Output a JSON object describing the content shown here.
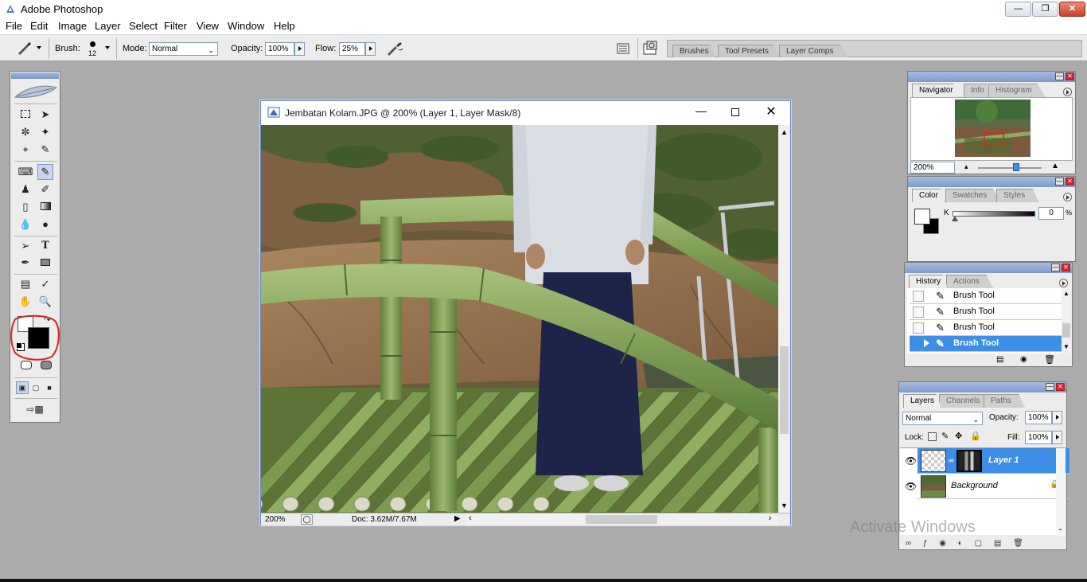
{
  "app": {
    "title": "Adobe Photoshop"
  },
  "menu": [
    "File",
    "Edit",
    "Image",
    "Layer",
    "Select",
    "Filter",
    "View",
    "Window",
    "Help"
  ],
  "options": {
    "brush_label": "Brush:",
    "brush_size": "12",
    "mode_label": "Mode:",
    "mode_value": "Normal",
    "opacity_label": "Opacity:",
    "opacity_value": "100%",
    "flow_label": "Flow:",
    "flow_value": "25%",
    "well_tabs": [
      "Brushes",
      "Tool Presets",
      "Layer Comps"
    ]
  },
  "document": {
    "title": "Jembatan Kolam.JPG @ 200% (Layer 1, Layer Mask/8)",
    "zoom": "200%",
    "doc_info": "Doc: 3.62M/7.67M"
  },
  "navigator": {
    "tabs": [
      "Navigator",
      "Info",
      "Histogram"
    ],
    "zoom": "200%"
  },
  "color": {
    "tabs": [
      "Color",
      "Swatches",
      "Styles"
    ],
    "channel_label": "K",
    "value": "0",
    "unit": "%"
  },
  "history": {
    "tabs": [
      "History",
      "Actions"
    ],
    "items": [
      "Brush Tool",
      "Brush Tool",
      "Brush Tool",
      "Brush Tool"
    ]
  },
  "layers": {
    "tabs": [
      "Layers",
      "Channels",
      "Paths"
    ],
    "blend_mode": "Normal",
    "opacity_label": "Opacity:",
    "opacity_value": "100%",
    "lock_label": "Lock:",
    "fill_label": "Fill:",
    "fill_value": "100%",
    "items": [
      "Layer 1",
      "Background"
    ]
  },
  "watermark": "Activate Windows",
  "colors": {
    "accent": "#3d8ee6",
    "panel_header": "#8aa3cf",
    "highlight_circle": "#e0201c"
  }
}
